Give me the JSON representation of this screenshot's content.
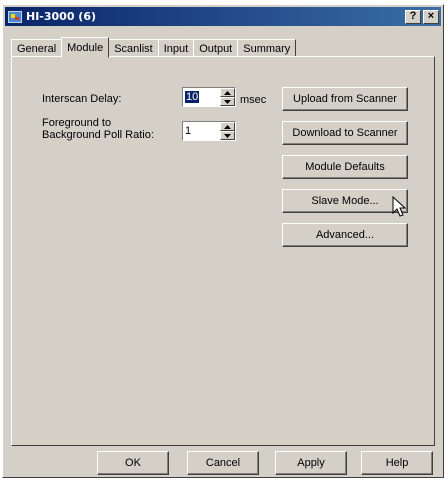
{
  "window": {
    "title": "HI-3000 (6)",
    "help_button": "?",
    "close_button": "×"
  },
  "tabs": [
    {
      "label": "General",
      "active": false
    },
    {
      "label": "Module",
      "active": true
    },
    {
      "label": "Scanlist",
      "active": false
    },
    {
      "label": "Input",
      "active": false
    },
    {
      "label": "Output",
      "active": false
    },
    {
      "label": "Summary",
      "active": false
    }
  ],
  "module": {
    "interscan_delay": {
      "label": "Interscan Delay:",
      "value": "10",
      "unit": "msec"
    },
    "poll_ratio": {
      "label_line1": "Foreground to",
      "label_line2": "Background Poll Ratio:",
      "value": "1"
    },
    "buttons": {
      "upload": "Upload from Scanner",
      "download": "Download to Scanner",
      "defaults": "Module Defaults",
      "slave_mode": "Slave Mode...",
      "advanced": "Advanced..."
    }
  },
  "footer": {
    "ok": "OK",
    "cancel": "Cancel",
    "apply": "Apply",
    "help": "Help"
  },
  "colors": {
    "dialog_face": "#d4d0c8",
    "titlebar_start": "#0a246a",
    "titlebar_end": "#3a6ea5",
    "selection": "#0a246a"
  },
  "icons": {
    "app": "scanner-app-icon",
    "cursor": "mouse-pointer-icon"
  }
}
